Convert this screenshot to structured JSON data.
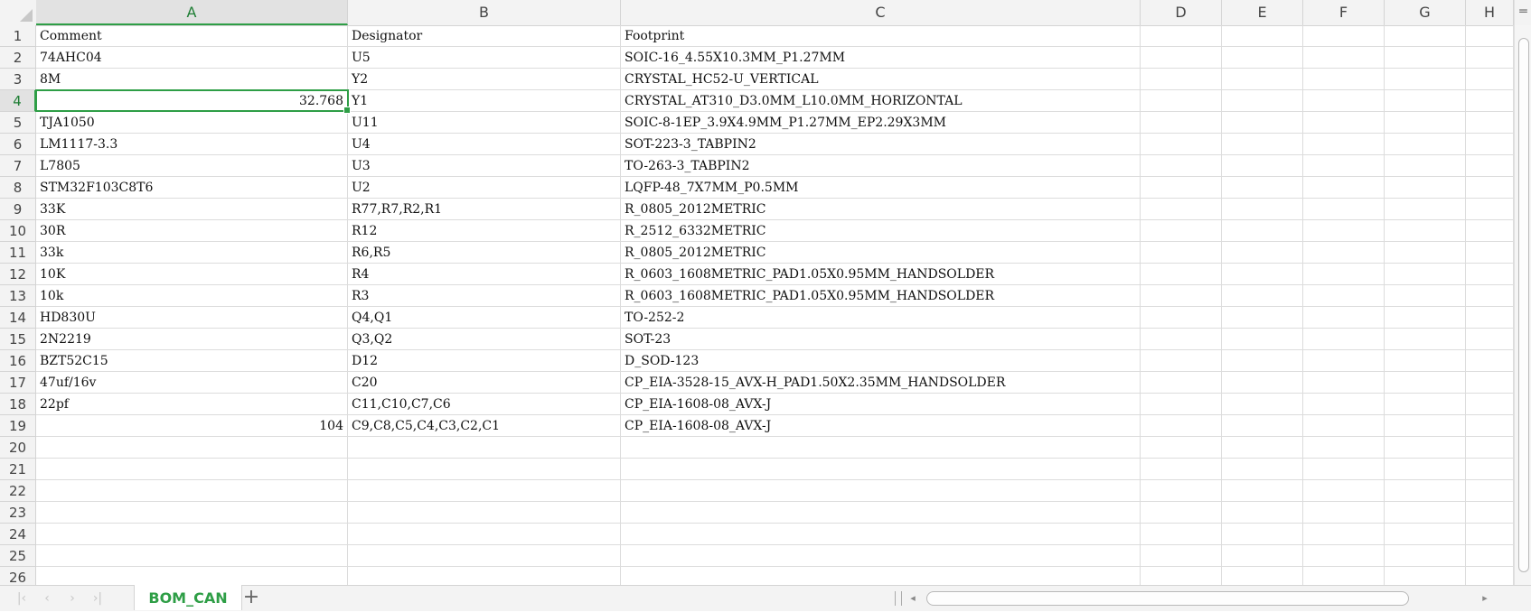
{
  "columns": [
    {
      "label": "",
      "width": 40
    },
    {
      "label": "A"
    },
    {
      "label": "B"
    },
    {
      "label": "C"
    },
    {
      "label": "D"
    },
    {
      "label": "E"
    },
    {
      "label": "F"
    },
    {
      "label": "G"
    },
    {
      "label": "H"
    }
  ],
  "selected_column": "A",
  "selected_row": 4,
  "rows": [
    {
      "n": "1",
      "a": "Comment",
      "b": "Designator",
      "c": "Footprint"
    },
    {
      "n": "2",
      "a": "74AHC04",
      "b": "U5",
      "c": "SOIC-16_4.55X10.3MM_P1.27MM"
    },
    {
      "n": "3",
      "a": "8M",
      "b": "Y2",
      "c": "CRYSTAL_HC52-U_VERTICAL"
    },
    {
      "n": "4",
      "a": "32.768",
      "b": "Y1",
      "c": "CRYSTAL_AT310_D3.0MM_L10.0MM_HORIZONTAL",
      "a_num": true
    },
    {
      "n": "5",
      "a": "TJA1050",
      "b": "U11",
      "c": "SOIC-8-1EP_3.9X4.9MM_P1.27MM_EP2.29X3MM"
    },
    {
      "n": "6",
      "a": "LM1117-3.3",
      "b": "U4",
      "c": "SOT-223-3_TABPIN2"
    },
    {
      "n": "7",
      "a": "L7805",
      "b": "U3",
      "c": "TO-263-3_TABPIN2"
    },
    {
      "n": "8",
      "a": "STM32F103C8T6",
      "b": "U2",
      "c": "LQFP-48_7X7MM_P0.5MM"
    },
    {
      "n": "9",
      "a": "33K",
      "b": "R77,R7,R2,R1",
      "c": "R_0805_2012METRIC"
    },
    {
      "n": "10",
      "a": "30R",
      "b": "R12",
      "c": "R_2512_6332METRIC"
    },
    {
      "n": "11",
      "a": "33k",
      "b": "R6,R5",
      "c": "R_0805_2012METRIC"
    },
    {
      "n": "12",
      "a": "10K",
      "b": "R4",
      "c": "R_0603_1608METRIC_PAD1.05X0.95MM_HANDSOLDER"
    },
    {
      "n": "13",
      "a": "10k",
      "b": "R3",
      "c": "R_0603_1608METRIC_PAD1.05X0.95MM_HANDSOLDER"
    },
    {
      "n": "14",
      "a": "HD830U",
      "b": "Q4,Q1",
      "c": "TO-252-2"
    },
    {
      "n": "15",
      "a": "2N2219",
      "b": "Q3,Q2",
      "c": "SOT-23"
    },
    {
      "n": "16",
      "a": "BZT52C15",
      "b": "D12",
      "c": "D_SOD-123"
    },
    {
      "n": "17",
      "a": "47uf/16v",
      "b": "C20",
      "c": "CP_EIA-3528-15_AVX-H_PAD1.50X2.35MM_HANDSOLDER"
    },
    {
      "n": "18",
      "a": "22pf",
      "b": "C11,C10,C7,C6",
      "c": "CP_EIA-1608-08_AVX-J"
    },
    {
      "n": "19",
      "a": "104",
      "b": "C9,C8,C5,C4,C3,C2,C1",
      "c": "CP_EIA-1608-08_AVX-J",
      "a_num": true
    },
    {
      "n": "20",
      "a": "",
      "b": "",
      "c": ""
    },
    {
      "n": "21",
      "a": "",
      "b": "",
      "c": ""
    },
    {
      "n": "22",
      "a": "",
      "b": "",
      "c": ""
    },
    {
      "n": "23",
      "a": "",
      "b": "",
      "c": ""
    },
    {
      "n": "24",
      "a": "",
      "b": "",
      "c": ""
    },
    {
      "n": "25",
      "a": "",
      "b": "",
      "c": ""
    },
    {
      "n": "26",
      "a": "",
      "b": "",
      "c": ""
    }
  ],
  "sheet_tabs": [
    {
      "label": "BOM_CAN",
      "active": true
    }
  ],
  "add_sheet_icon": "plus-icon"
}
